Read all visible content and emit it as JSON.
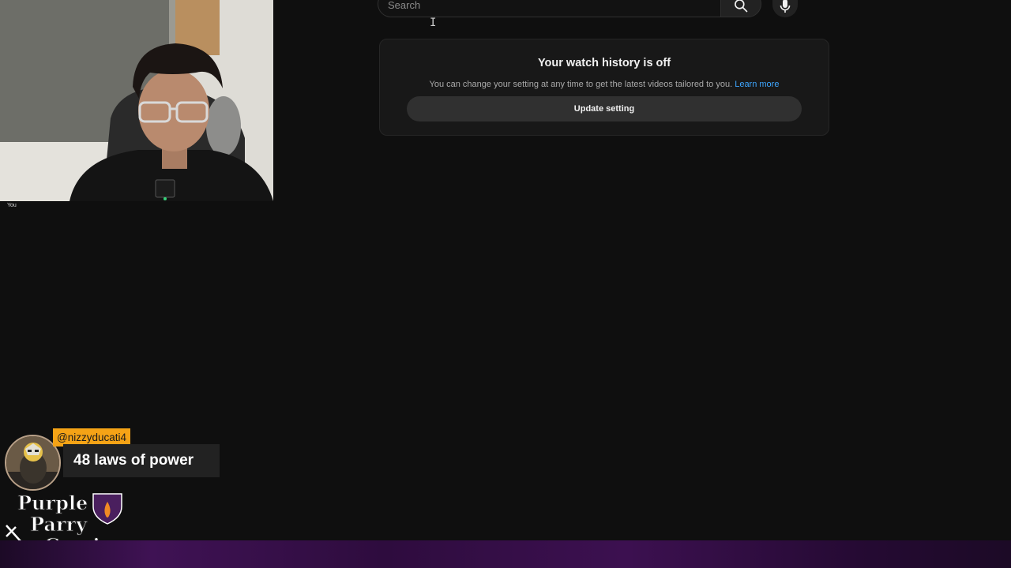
{
  "search": {
    "placeholder": "Search",
    "search_icon": "search-icon",
    "mic_icon": "microphone-icon"
  },
  "history_card": {
    "title": "Your watch history is off",
    "description": "You can change your setting at any time to get the latest videos tailored to you.",
    "link_label": "Learn more",
    "button_label": "Update setting"
  },
  "webcam": {
    "label": "You"
  },
  "chat": {
    "username": "@nizzyducati4",
    "message": "48 laws of power"
  },
  "logo": {
    "line1": "Purple",
    "line2": "Parry",
    "line3": "Gaming"
  },
  "colors": {
    "background": "#0f0f0f",
    "link": "#3ea6ff",
    "chat_username_bg": "#f5a316",
    "bottom_bar": "#3f1254"
  }
}
